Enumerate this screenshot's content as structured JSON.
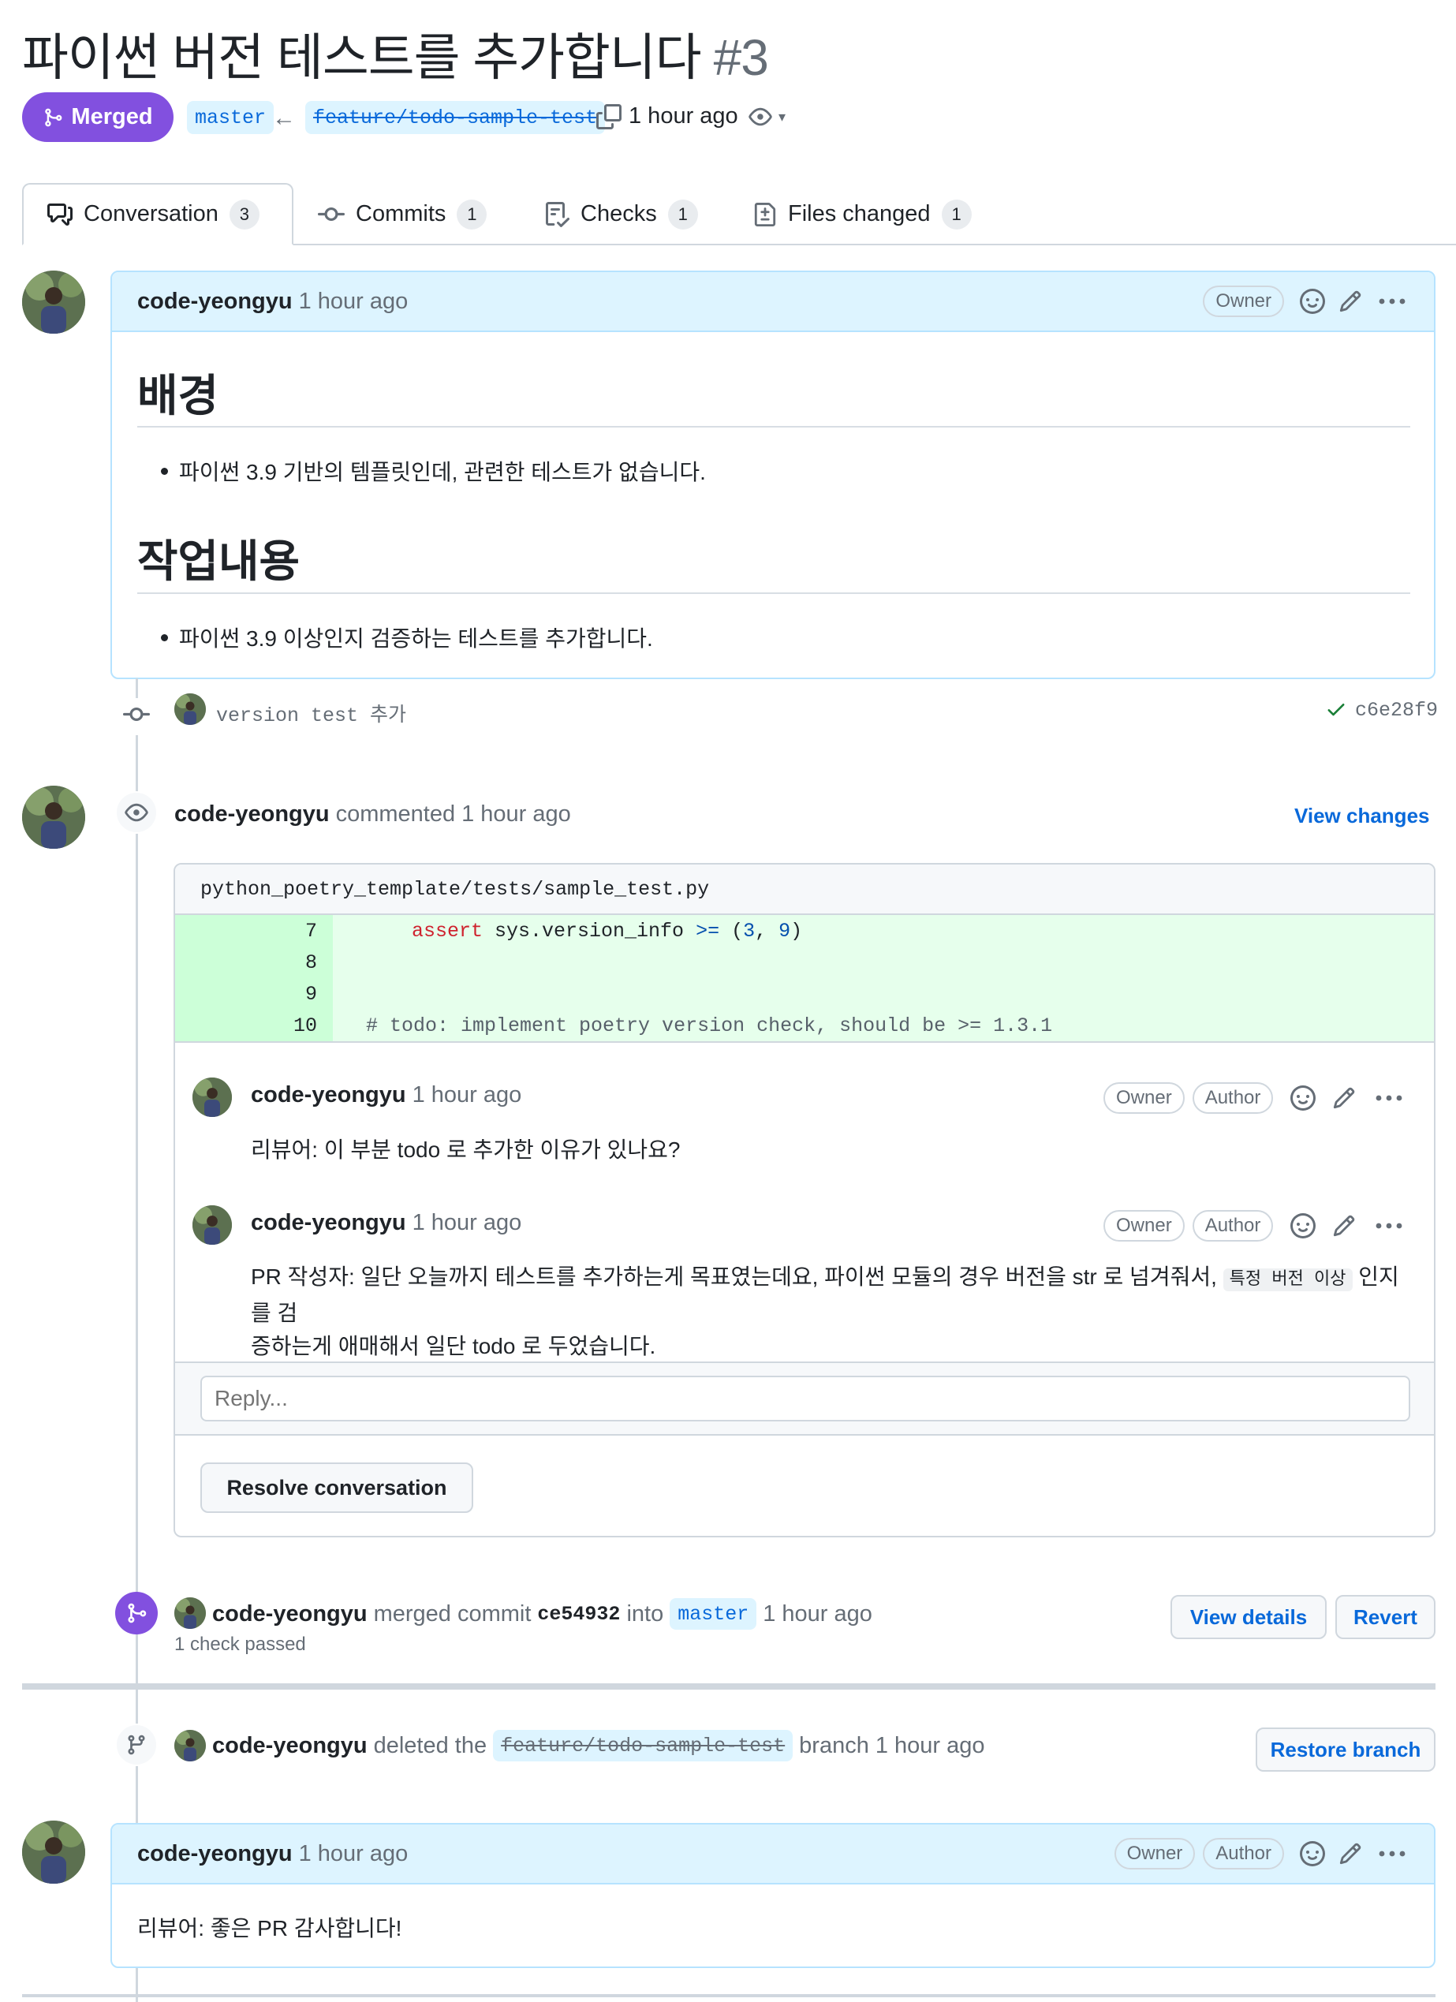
{
  "pr": {
    "title": "파이썬 버전 테스트를 추가합니다",
    "number": "#3",
    "state": "Merged",
    "base_branch": "master",
    "head_branch": "feature/todo-sample-test",
    "merged_time": "1 hour ago"
  },
  "tabs": [
    {
      "label": "Conversation",
      "count": "3"
    },
    {
      "label": "Commits",
      "count": "1"
    },
    {
      "label": "Checks",
      "count": "1"
    },
    {
      "label": "Files changed",
      "count": "1"
    }
  ],
  "first_comment": {
    "user": "code-yeongyu",
    "time": "1 hour ago",
    "role": "Owner",
    "heading1": "배경",
    "bullet1": "파이썬 3.9 기반의 템플릿인데, 관련한 테스트가 없습니다.",
    "heading2": "작업내용",
    "bullet2": "파이썬 3.9 이상인지 검증하는 테스트를 추가합니다."
  },
  "commit": {
    "message": "version test 추가",
    "sha": "c6e28f9"
  },
  "review": {
    "user": "code-yeongyu",
    "action": "commented",
    "time": "1 hour ago",
    "view_changes": "View changes",
    "file_path": "python_poetry_template/tests/sample_test.py",
    "code_lines": [
      {
        "num": "7",
        "keyword": "assert",
        "text": " sys.version_info ",
        "op": ">=",
        "rest_open": " (",
        "n1": "3",
        "comma": ", ",
        "n2": "9",
        "close": ")"
      },
      {
        "num": "8",
        "text": ""
      },
      {
        "num": "9",
        "text": ""
      },
      {
        "num": "10",
        "text": "# todo: implement poetry version check, should be >= 1.3.1"
      }
    ],
    "thread": [
      {
        "user": "code-yeongyu",
        "time": "1 hour ago",
        "role1": "Owner",
        "role2": "Author",
        "body": "리뷰어: 이 부분 todo 로 추가한 이유가 있나요?"
      },
      {
        "user": "code-yeongyu",
        "time": "1 hour ago",
        "role1": "Owner",
        "role2": "Author",
        "body_part1": "PR 작성자: 일단 오늘까지 테스트를 추가하는게 목표였는데요, 파이썬 모듈의 경우 버전을 str 로 넘겨줘서,",
        "body_code": "특정 버전 이상",
        "body_part2": "인지를 검",
        "body_line2": "증하는게 애매해서 일단 todo 로 두었습니다."
      }
    ],
    "reply_placeholder": "Reply...",
    "resolve_label": "Resolve conversation"
  },
  "merge_event": {
    "user": "code-yeongyu",
    "text1": "merged commit",
    "sha": "ce54932",
    "text2": "into",
    "branch": "master",
    "time": "1 hour ago",
    "checks": "1 check passed",
    "view_details": "View details",
    "revert": "Revert"
  },
  "delete_event": {
    "user": "code-yeongyu",
    "text1": "deleted the",
    "branch": "feature/todo-sample-test",
    "text2": "branch",
    "time": "1 hour ago",
    "restore": "Restore branch"
  },
  "last_comment": {
    "user": "code-yeongyu",
    "time": "1 hour ago",
    "role1": "Owner",
    "role2": "Author",
    "body": "리뷰어: 좋은 PR 감사합니다!"
  },
  "colors": {
    "merged_purple": "#8250df",
    "link_blue": "#0969da",
    "comment_header_bg": "#ddf4ff",
    "diff_added_bg": "#e6ffec",
    "success_green": "#1a7f37"
  }
}
